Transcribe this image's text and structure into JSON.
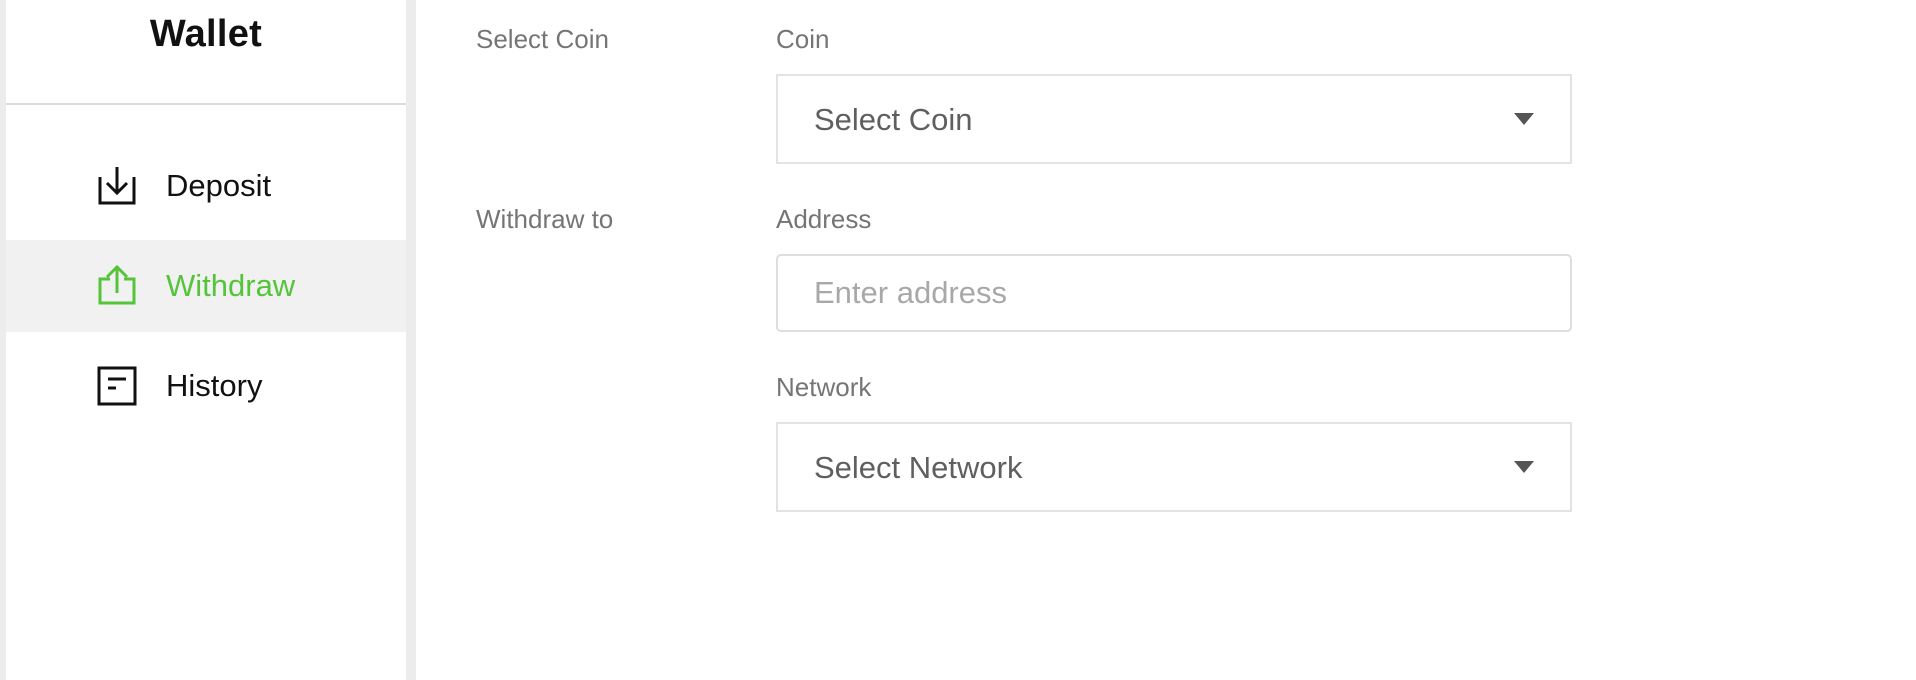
{
  "sidebar": {
    "title": "Wallet",
    "items": [
      {
        "label": "Deposit",
        "icon": "deposit-icon",
        "active": false
      },
      {
        "label": "Withdraw",
        "icon": "withdraw-icon",
        "active": true
      },
      {
        "label": "History",
        "icon": "history-icon",
        "active": false
      }
    ]
  },
  "form": {
    "select_coin_section_label": "Select Coin",
    "coin_label": "Coin",
    "coin_select_value": "Select Coin",
    "withdraw_to_section_label": "Withdraw to",
    "address_label": "Address",
    "address_placeholder": "Enter address",
    "address_value": "",
    "network_label": "Network",
    "network_select_value": "Select Network"
  },
  "colors": {
    "accent": "#55c43b",
    "text_primary": "#111111",
    "text_muted": "#757575",
    "active_bg": "#f1f1f1",
    "border": "#e3e3e3"
  }
}
